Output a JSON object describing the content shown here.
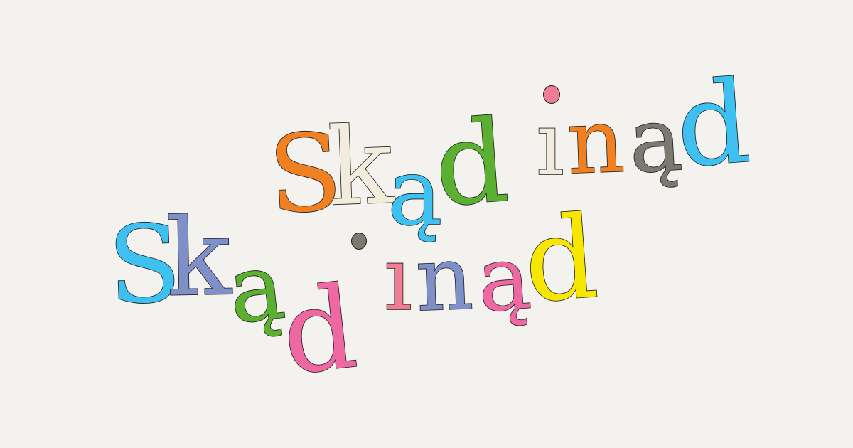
{
  "logo": {
    "letters": [
      {
        "ch": "S",
        "color": "#f08021"
      },
      {
        "ch": "k",
        "color": "#f1ecdc"
      },
      {
        "ch": "ą",
        "color": "#3ec1f0"
      },
      {
        "ch": "d",
        "color": "#5cb031"
      },
      {
        "ch": "ı",
        "color": "#f1ecdc"
      },
      {
        "ch": "n",
        "color": "#f08021"
      },
      {
        "ch": "ą",
        "color": "#7c7a70"
      },
      {
        "ch": "d",
        "color": "#3ec1f0"
      },
      {
        "ch": "S",
        "color": "#3ec1f0"
      },
      {
        "ch": "k",
        "color": "#7f8fc8"
      },
      {
        "ch": "ą",
        "color": "#5cb031"
      },
      {
        "ch": "d",
        "color": "#ee68a2"
      },
      {
        "ch": "ı",
        "color": "#ef7d93"
      },
      {
        "ch": "n",
        "color": "#7f8fc8"
      },
      {
        "ch": "ą",
        "color": "#ee68a2"
      },
      {
        "ch": "d",
        "color": "#f7e600"
      }
    ],
    "dots": [
      {
        "color": "#ef7d93"
      },
      {
        "color": "#7c7a70"
      }
    ]
  }
}
